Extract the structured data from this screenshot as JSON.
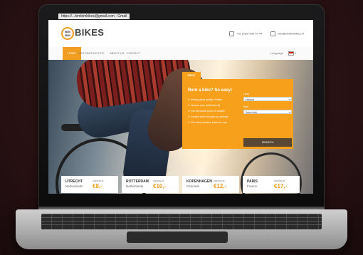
{
  "browser": {
    "tab_title": "https://...bimbimbikes@gmail.com - Gmail"
  },
  "header": {
    "logo_line1": "BIM",
    "logo_line2": "BIM",
    "brand": "BIKES",
    "phone": "+31 (0)20 000 70 44",
    "email": "info@bimbimbikes.nl"
  },
  "nav": {
    "items": [
      "HOME",
      "DESTINATION TIPS",
      "ABOUT US",
      "CONTACT"
    ],
    "language_label": "Language"
  },
  "form": {
    "tab_label": "RENT",
    "title": "Rent a bike? So easy!",
    "benefits": [
      "Always great quality of bikes",
      "Choose your preferred city",
      "Get the lowest price on market",
      "Contact them through our website",
      "The best exclusive prices for you"
    ],
    "country_label": "Land",
    "country_value": "Holland",
    "city_label": "Stad",
    "city_value": "Select city",
    "search_label": "SEARCH"
  },
  "destinations": [
    {
      "city": "UTRECHT",
      "country": "Netherlands",
      "from": "starting at",
      "price": "€8,-"
    },
    {
      "city": "ROTTERDAM",
      "country": "Netherlands",
      "from": "starting at",
      "price": "€10,-"
    },
    {
      "city": "KOPENHAGEN",
      "country": "Denmark",
      "from": "starting at",
      "price": "€12,-"
    },
    {
      "city": "PARIS",
      "country": "France",
      "from": "starting at",
      "price": "€17,-"
    }
  ],
  "colors": {
    "accent": "#f29d1f",
    "button": "#5a4733",
    "background": "#2f1417"
  }
}
